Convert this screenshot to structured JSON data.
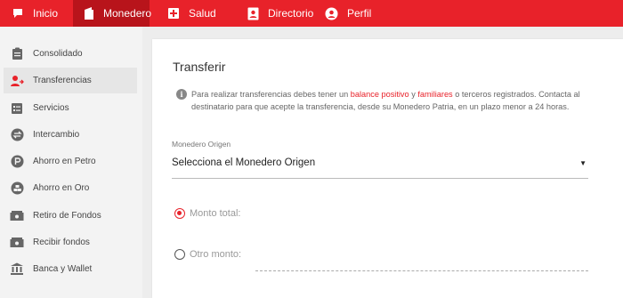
{
  "colors": {
    "brand": "#e8222a",
    "active_nav": "#b8141b"
  },
  "topnav": [
    {
      "label": "Inicio",
      "icon": "chat-bubble-icon",
      "active": false
    },
    {
      "label": "Monedero",
      "icon": "wallet-icon",
      "active": true
    },
    {
      "label": "Salud",
      "icon": "medical-cross-icon",
      "active": false
    },
    {
      "label": "Directorio",
      "icon": "contact-card-icon",
      "active": false
    },
    {
      "label": "Perfil",
      "icon": "user-circle-icon",
      "active": false
    }
  ],
  "sidebar": {
    "items": [
      {
        "label": "Consolidado",
        "icon": "clipboard-icon",
        "active": false
      },
      {
        "label": "Transferencias",
        "icon": "user-transfer-icon",
        "active": true
      },
      {
        "label": "Servicios",
        "icon": "list-icon",
        "active": false
      },
      {
        "label": "Intercambio",
        "icon": "exchange-icon",
        "active": false
      },
      {
        "label": "Ahorro en Petro",
        "icon": "petro-coin-icon",
        "active": false
      },
      {
        "label": "Ahorro en Oro",
        "icon": "gold-bars-icon",
        "active": false
      },
      {
        "label": "Retiro de Fondos",
        "icon": "money-withdraw-icon",
        "active": false
      },
      {
        "label": "Recibir fondos",
        "icon": "money-receive-icon",
        "active": false
      },
      {
        "label": "Banca y Wallet",
        "icon": "bank-icon",
        "active": false
      }
    ]
  },
  "main": {
    "title": "Transferir",
    "info": {
      "part1": "Para realizar transferencias debes tener un ",
      "link1": "balance positivo",
      "part2": " y ",
      "link2": "familiares",
      "part3": " o terceros registrados. Contacta al destinatario para que acepte la transferencia, desde su Monedero Patria, en un plazo menor a 24 horas."
    },
    "origen_label": "Monedero Origen",
    "origen_value": "Selecciona el Monedero Origen",
    "monto_total_label": "Monto total:",
    "otro_monto_label": "Otro monto:",
    "selected_amount_option": "Monto total:"
  }
}
